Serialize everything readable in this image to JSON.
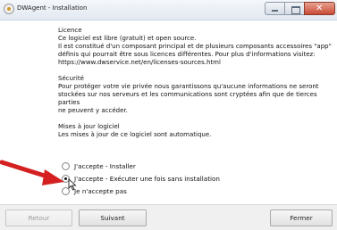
{
  "window": {
    "title": "DWAgent - Installation"
  },
  "sections": [
    {
      "heading": "Licence",
      "lines": [
        "Ce logiciel est libre (gratuit) et open source.",
        "Il est constitué d'un composant principal et de plusieurs composants accessoires \"app\"",
        "définis qui pourrait être sous licences différentes. Pour plus d'informations visitez:",
        "https://www.dwservice.net/en/licenses-sources.html"
      ]
    },
    {
      "heading": "Sécurité",
      "lines": [
        "Pour protéger votre vie privée nous garantissons qu'aucune informations ne seront",
        "stockées sur nos serveurs et les communications sont cryptées afin que de tierces parties",
        "ne peuvent y accéder."
      ]
    },
    {
      "heading": "Mises à jour logiciel",
      "lines": [
        "Les mises à jour de ce logiciel sont automatique."
      ]
    }
  ],
  "options": [
    {
      "label": "J'accepte - Installer",
      "checked": false
    },
    {
      "label": "J'accepte - Exécuter une fois sans installation",
      "checked": true
    },
    {
      "label": "Je n'accepte pas",
      "checked": false
    }
  ],
  "footer": {
    "back_label": "Retour",
    "next_label": "Suivant",
    "close_label": "Fermer"
  },
  "colors": {
    "annotation_arrow": "#d42020"
  }
}
